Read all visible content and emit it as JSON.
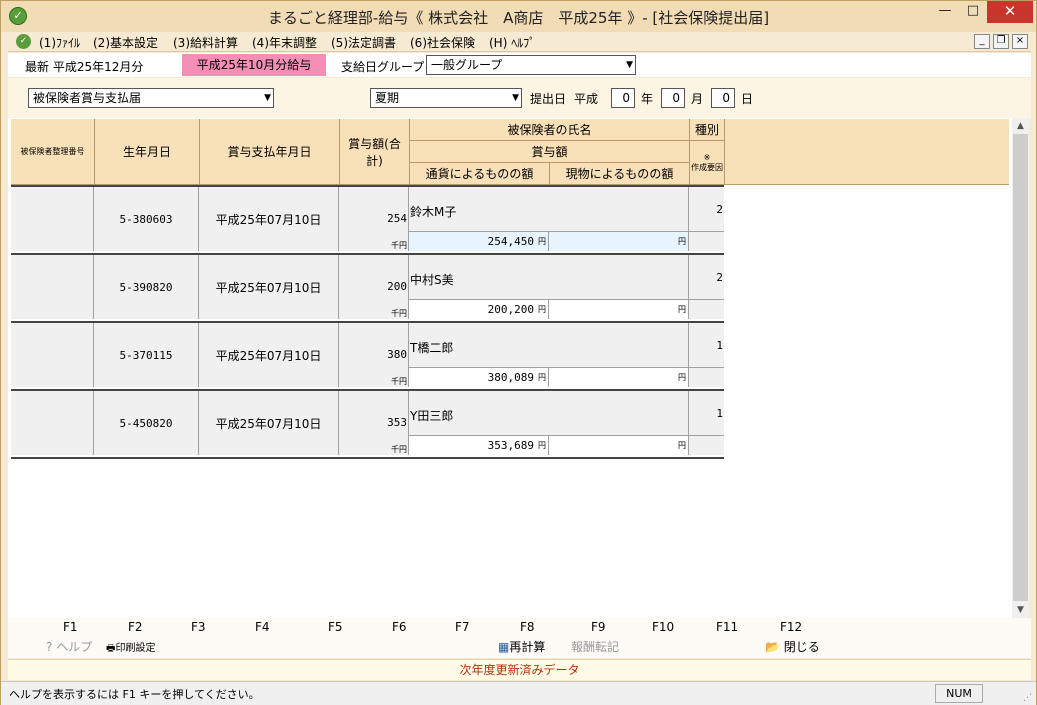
{
  "window": {
    "title": "まるごと経理部-給与《 株式会社　A商店　平成25年 》- [社会保険提出届]",
    "icon": "app-logo-icon"
  },
  "menu": {
    "items": [
      "(1)ﾌｧｲﾙ",
      "(2)基本設定",
      "(3)給料計算",
      "(4)年末調整",
      "(5)法定調書",
      "(6)社会保険",
      "(H) ﾍﾙﾌﾟ"
    ]
  },
  "info": {
    "latest": "最新 平成25年12月分",
    "period": "平成25年10月分給与",
    "group_label": "支給日グループ",
    "group_value": "一般グループ"
  },
  "filter": {
    "form_type": "被保険者賞与支払届",
    "season": "夏期",
    "submit_label": "提出日",
    "era": "平成",
    "year": "0",
    "year_unit": "年",
    "month": "0",
    "month_unit": "月",
    "day": "0",
    "day_unit": "日"
  },
  "headers": {
    "insured_no": "被保険者整理番号",
    "birth": "生年月日",
    "paid_date": "賞与支払年月日",
    "total": "賞与額(合計)",
    "name": "被保険者の氏名",
    "bonus": "賞与額",
    "cash": "通貨によるものの額",
    "kind": "現物によるものの額",
    "type": "種別",
    "reason_mark": "※",
    "reason": "作成要因"
  },
  "rows": [
    {
      "no": "",
      "birth": "5-380603",
      "paid_date": "平成25年07月10日",
      "total": "254",
      "total_unit": "千円",
      "name": "鈴木M子",
      "cash": "254,450",
      "cash_unit": "円",
      "kind_unit": "円",
      "type": "2"
    },
    {
      "no": "",
      "birth": "5-390820",
      "paid_date": "平成25年07月10日",
      "total": "200",
      "total_unit": "千円",
      "name": "中村S美",
      "cash": "200,200",
      "cash_unit": "円",
      "kind_unit": "円",
      "type": "2"
    },
    {
      "no": "",
      "birth": "5-370115",
      "paid_date": "平成25年07月10日",
      "total": "380",
      "total_unit": "千円",
      "name": "T橋二郎",
      "cash": "380,089",
      "cash_unit": "円",
      "kind_unit": "円",
      "type": "1"
    },
    {
      "no": "",
      "birth": "5-450820",
      "paid_date": "平成25年07月10日",
      "total": "353",
      "total_unit": "千円",
      "name": "Y田三郎",
      "cash": "353,689",
      "cash_unit": "円",
      "kind_unit": "円",
      "type": "1"
    }
  ],
  "fkeys": {
    "labels": [
      "F1",
      "F2",
      "F3",
      "F4",
      "F5",
      "F6",
      "F7",
      "F8",
      "F9",
      "F10",
      "F11",
      "F12"
    ],
    "help": "ヘルプ",
    "print": "印刷設定",
    "recalc": "再計算",
    "transfer": "報酬転記",
    "close": "閉じる"
  },
  "notice": "次年度更新済みデータ",
  "status": {
    "message": "ヘルプを表示するには F1 キーを押してください。",
    "num": "NUM"
  },
  "colors": {
    "header_bg": "#f8e0b8",
    "period_badge": "#f38fb4",
    "notice_text": "#b43010"
  }
}
